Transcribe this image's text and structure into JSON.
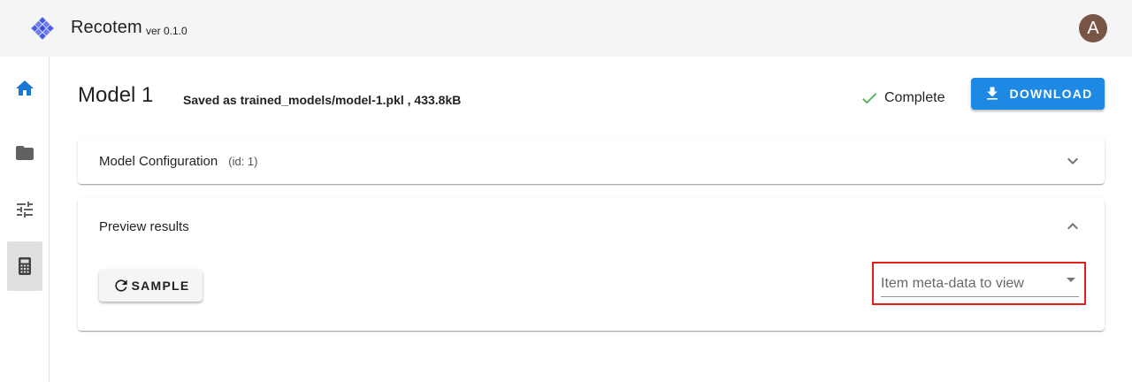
{
  "app": {
    "title": "Recotem",
    "version": "ver 0.1.0",
    "avatar_initial": "A",
    "brand_color": "#4b5fe8"
  },
  "sidebar": {
    "items": [
      {
        "icon": "home-icon",
        "active": false
      },
      {
        "icon": "folder-icon",
        "active": false
      },
      {
        "icon": "tune-icon",
        "active": false
      },
      {
        "icon": "calculator-icon",
        "active": true
      }
    ]
  },
  "page": {
    "title": "Model 1",
    "saved_info": "Saved as trained_models/model-1.pkl , 433.8kB",
    "status_text": "Complete",
    "status_color": "#4caf50",
    "download_label": "DOWNLOAD",
    "download_color": "#1e88e5"
  },
  "panels": {
    "config": {
      "title": "Model Configuration",
      "id_text": "(id: 1)",
      "expanded": false
    },
    "preview": {
      "title": "Preview results",
      "expanded": true,
      "sample_label": "SAMPLE",
      "meta_placeholder": "Item meta-data to view"
    }
  }
}
